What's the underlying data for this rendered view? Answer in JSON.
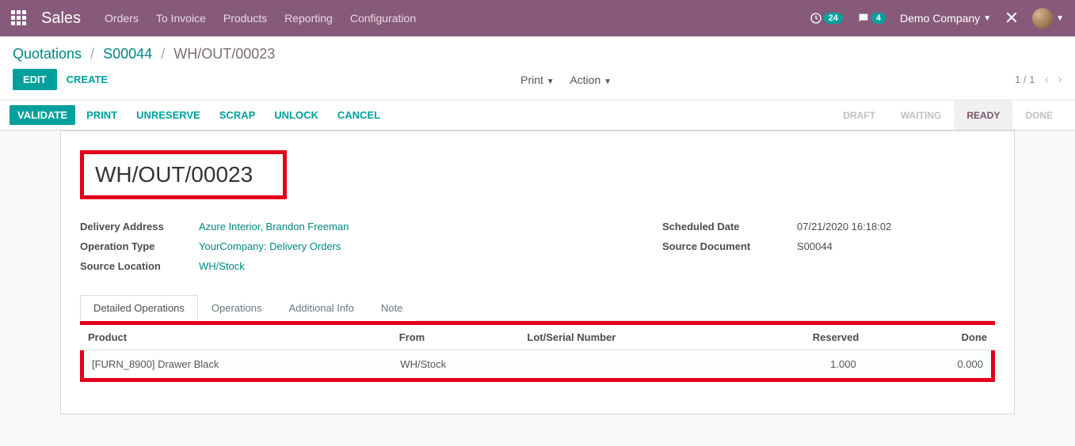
{
  "navbar": {
    "brand": "Sales",
    "menu": [
      "Orders",
      "To Invoice",
      "Products",
      "Reporting",
      "Configuration"
    ],
    "activity_badge": "24",
    "chat_badge": "4",
    "company": "Demo Company"
  },
  "breadcrumb": {
    "root": "Quotations",
    "mid": "S00044",
    "current": "WH/OUT/00023"
  },
  "controls": {
    "edit": "EDIT",
    "create": "CREATE",
    "print": "Print",
    "action": "Action",
    "pager": "1 / 1"
  },
  "statusbar": {
    "buttons": [
      "VALIDATE",
      "PRINT",
      "UNRESERVE",
      "SCRAP",
      "UNLOCK",
      "CANCEL"
    ],
    "steps": [
      "DRAFT",
      "WAITING",
      "READY",
      "DONE"
    ],
    "active_step": "READY"
  },
  "record": {
    "title": "WH/OUT/00023",
    "left_fields": [
      {
        "label": "Delivery Address",
        "value": "Azure Interior, Brandon Freeman",
        "link": true
      },
      {
        "label": "Operation Type",
        "value": "YourCompany: Delivery Orders",
        "link": true
      },
      {
        "label": "Source Location",
        "value": "WH/Stock",
        "link": true
      }
    ],
    "right_fields": [
      {
        "label": "Scheduled Date",
        "value": "07/21/2020 16:18:02",
        "link": false
      },
      {
        "label": "Source Document",
        "value": "S00044",
        "link": false
      }
    ]
  },
  "tabs": [
    "Detailed Operations",
    "Operations",
    "Additional Info",
    "Note"
  ],
  "table": {
    "columns": [
      "Product",
      "From",
      "Lot/Serial Number",
      "Reserved",
      "Done"
    ],
    "rows": [
      {
        "product": "[FURN_8900] Drawer Black",
        "from": "WH/Stock",
        "lot": "",
        "reserved": "1.000",
        "done": "0.000"
      }
    ]
  }
}
